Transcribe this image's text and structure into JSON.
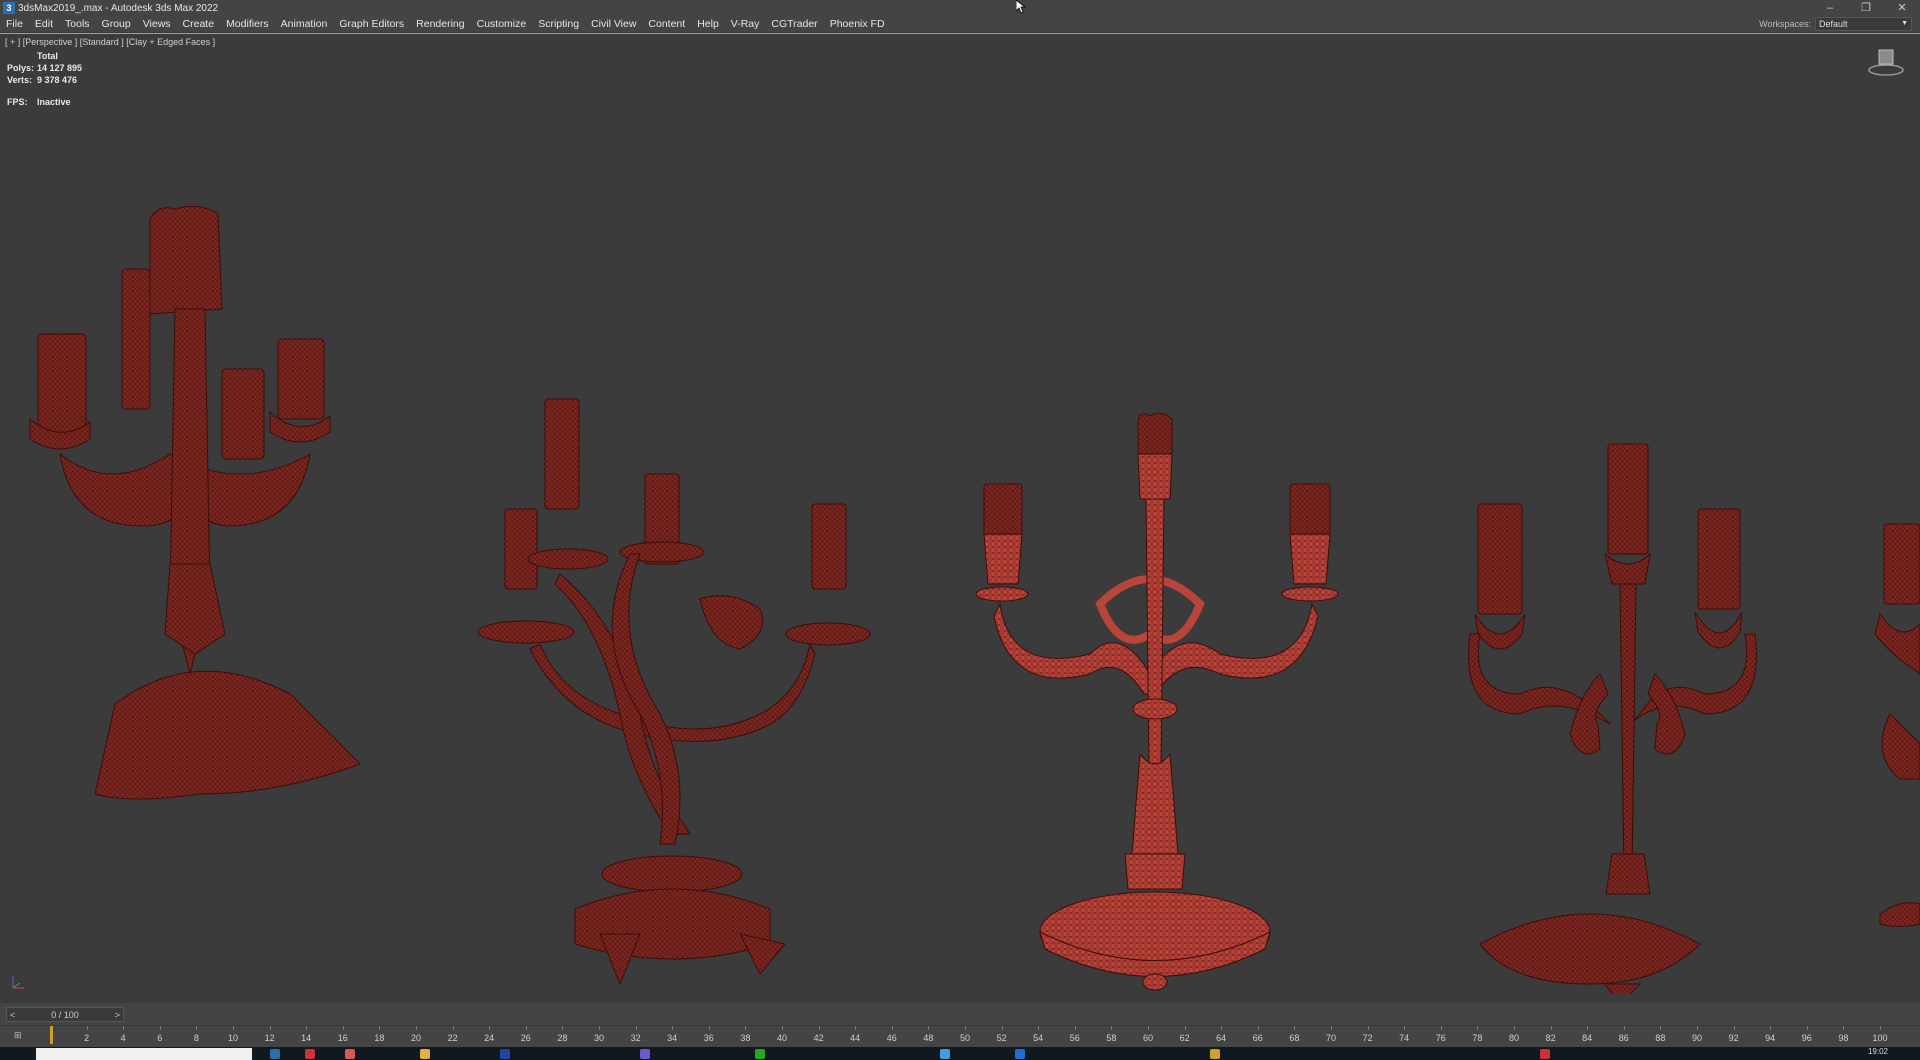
{
  "titlebar": {
    "app_icon": "3",
    "title": "3dsMax2019_.max - Autodesk 3ds Max 2022",
    "minimize": "–",
    "restore": "❐",
    "close": "✕"
  },
  "menu": [
    "File",
    "Edit",
    "Tools",
    "Group",
    "Views",
    "Create",
    "Modifiers",
    "Animation",
    "Graph Editors",
    "Rendering",
    "Customize",
    "Scripting",
    "Civil View",
    "Content",
    "Help",
    "V-Ray",
    "CGTrader",
    "Phoenix FD"
  ],
  "workspaces": {
    "label": "Workspaces:",
    "value": "Default"
  },
  "viewport": {
    "label": "[ + ] [Perspective ] [Standard ] [Clay + Edged Faces ]",
    "stats_header": "Total",
    "polys_label": "Polys:",
    "polys_value": "14 127 895",
    "verts_label": "Verts:",
    "verts_value": "9 378 476",
    "fps_label": "FPS:",
    "fps_value": "Inactive"
  },
  "time_slider": {
    "prev": "<",
    "value": "0 / 100",
    "next": ">"
  },
  "trackbar": {
    "icon": "⊞",
    "ticks": [
      "2",
      "4",
      "6",
      "8",
      "10",
      "12",
      "14",
      "16",
      "18",
      "20",
      "22",
      "24",
      "26",
      "28",
      "30",
      "32",
      "34",
      "36",
      "38",
      "40",
      "42",
      "44",
      "46",
      "48",
      "50",
      "52",
      "54",
      "56",
      "58",
      "60",
      "62",
      "64",
      "66",
      "68",
      "70",
      "72",
      "74",
      "76",
      "78",
      "80",
      "82",
      "84",
      "86",
      "88",
      "90",
      "92",
      "94",
      "96",
      "98",
      "100"
    ],
    "max_frame": 100
  },
  "taskbar": {
    "clock": "19:02"
  },
  "colors": {
    "accent": "#c9a227",
    "clay": "#8a2f28",
    "clay_dark": "#5a1612",
    "clay_light": "#c4493c"
  }
}
